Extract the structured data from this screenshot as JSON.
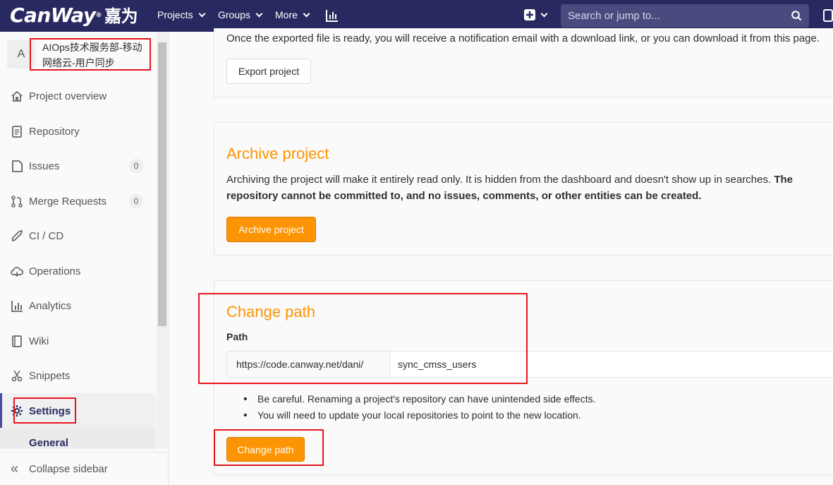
{
  "header": {
    "logo_text": "CanWay",
    "logo_cn": "嘉为",
    "nav": [
      "Projects",
      "Groups",
      "More"
    ],
    "search_placeholder": "Search or jump to..."
  },
  "sidebar": {
    "avatar_letter": "A",
    "project_name_line1": "AIOps技术服务部-移动",
    "project_name_line2": "网络云-用户同步",
    "items": [
      {
        "label": "Project overview",
        "icon": "home-icon"
      },
      {
        "label": "Repository",
        "icon": "doc-icon"
      },
      {
        "label": "Issues",
        "icon": "issues-icon",
        "count": "0"
      },
      {
        "label": "Merge Requests",
        "icon": "merge-icon",
        "count": "0"
      },
      {
        "label": "CI / CD",
        "icon": "rocket-icon"
      },
      {
        "label": "Operations",
        "icon": "cloud-icon"
      },
      {
        "label": "Analytics",
        "icon": "chart-icon"
      },
      {
        "label": "Wiki",
        "icon": "book-icon"
      },
      {
        "label": "Snippets",
        "icon": "scissors-icon"
      },
      {
        "label": "Settings",
        "icon": "gear-icon",
        "active": true
      }
    ],
    "sub_active": "General",
    "collapse_label": "Collapse sidebar"
  },
  "main": {
    "export_text": "Once the exported file is ready, you will receive a notification email with a download link, or you can download it from this page.",
    "export_button": "Export project",
    "archive": {
      "title": "Archive project",
      "desc_plain": "Archiving the project will make it entirely read only. It is hidden from the dashboard and doesn't show up in searches. ",
      "desc_bold_1": "The",
      "desc_bold_2": "repository cannot be committed to, and no issues, comments, or other entities can be created.",
      "button": "Archive project"
    },
    "change_path": {
      "title": "Change path",
      "label": "Path",
      "prefix": "https://code.canway.net/dani/",
      "value": "sync_cmss_users",
      "warnings": [
        "Be careful. Renaming a project's repository can have unintended side effects.",
        "You will need to update your local repositories to point to the new location."
      ],
      "button": "Change path"
    }
  },
  "colors": {
    "navbar": "#292961",
    "accent_orange": "#fc9403",
    "annotation_red": "#e8141c"
  }
}
